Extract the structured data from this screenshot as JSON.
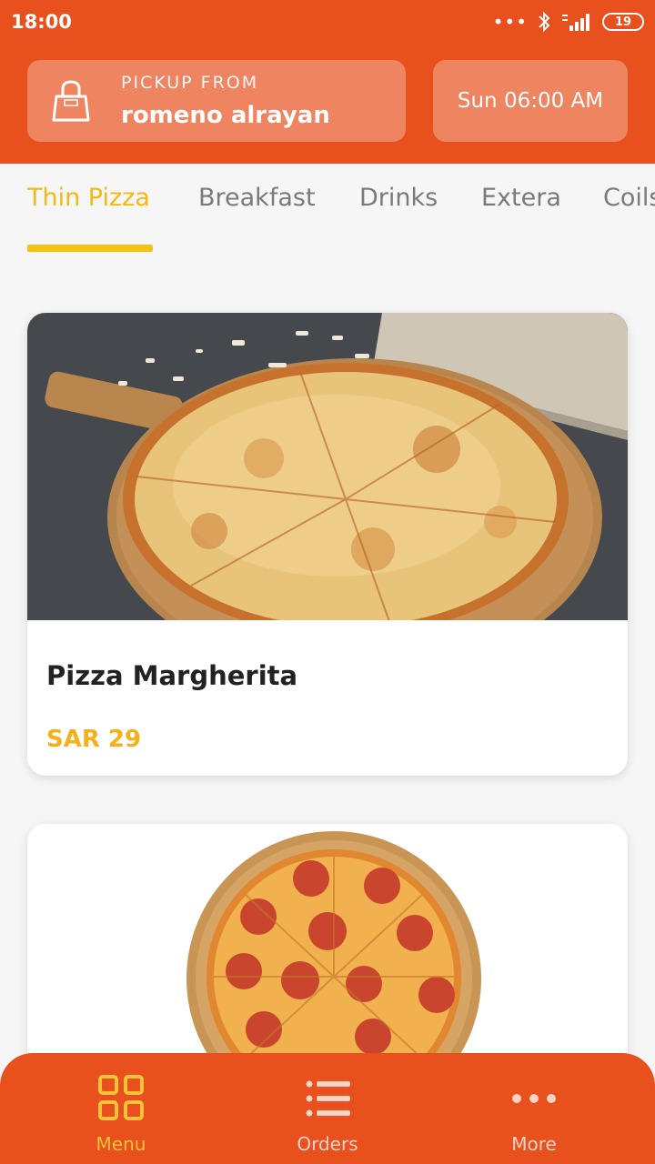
{
  "status_bar": {
    "time": "18:00",
    "battery": "19"
  },
  "header": {
    "pickup_label": "PICKUP FROM",
    "pickup_location": "romeno alrayan",
    "pickup_time": "Sun 06:00 AM"
  },
  "tabs": [
    {
      "label": "Thin Pizza",
      "active": true
    },
    {
      "label": "Breakfast",
      "active": false
    },
    {
      "label": "Drinks",
      "active": false
    },
    {
      "label": "Extera",
      "active": false
    },
    {
      "label": "Coils",
      "active": false
    }
  ],
  "menu_items": [
    {
      "name": "Pizza Margherita",
      "price": "SAR 29"
    }
  ],
  "bottom_nav": [
    {
      "label": "Menu",
      "icon": "grid-icon",
      "active": true
    },
    {
      "label": "Orders",
      "icon": "list-icon",
      "active": false
    },
    {
      "label": "More",
      "icon": "more-dots-icon",
      "active": false
    }
  ],
  "colors": {
    "brand": "#e8501e",
    "accent": "#f5b814"
  }
}
